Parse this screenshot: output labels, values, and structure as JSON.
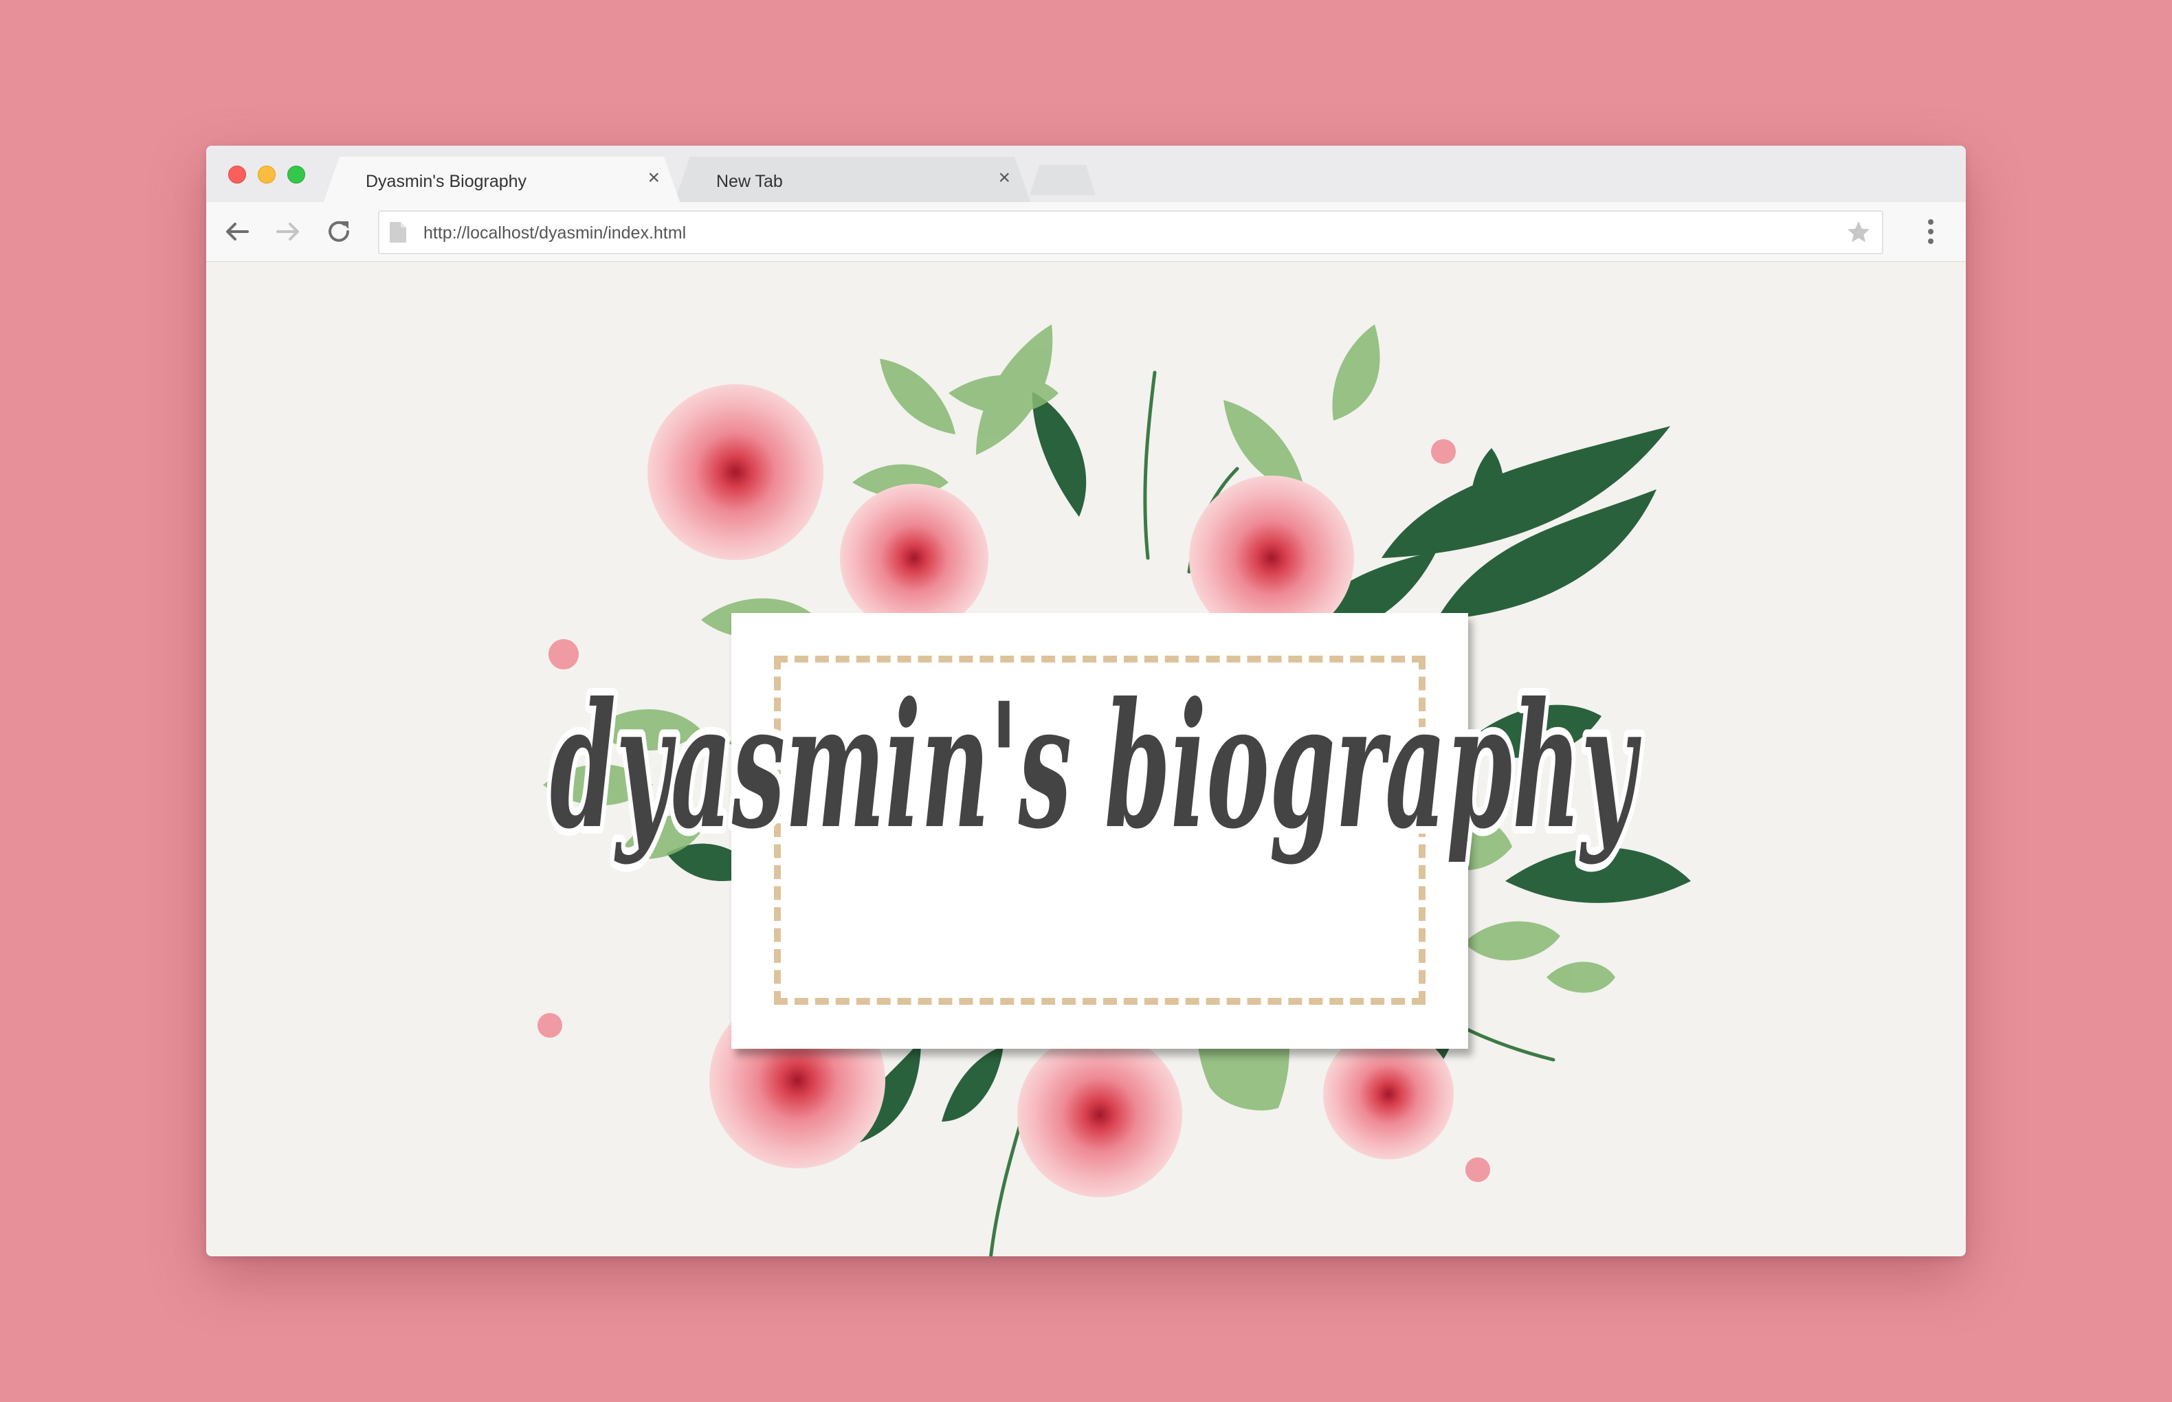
{
  "window": {
    "tabs": [
      {
        "label": "Dyasmin's Biography",
        "active": true
      },
      {
        "label": "New Tab",
        "active": false
      }
    ],
    "close_glyph": "×"
  },
  "toolbar": {
    "url": "http://localhost/dyasmin/index.html"
  },
  "page": {
    "headline": "dyasmin's biography"
  },
  "colors": {
    "background": "#e8909a",
    "page_background": "#f3f2ee",
    "frame_dash": "#ddc39b",
    "headline": "#444444",
    "rose": "#ee8f99",
    "leaf": "#7db36a",
    "dark_leaf": "#1e5a33"
  },
  "icons": {
    "back": "arrow-left-icon",
    "forward": "arrow-right-icon",
    "reload": "reload-icon",
    "page": "page-icon",
    "bookmark": "star-icon",
    "menu": "kebab-menu-icon"
  }
}
